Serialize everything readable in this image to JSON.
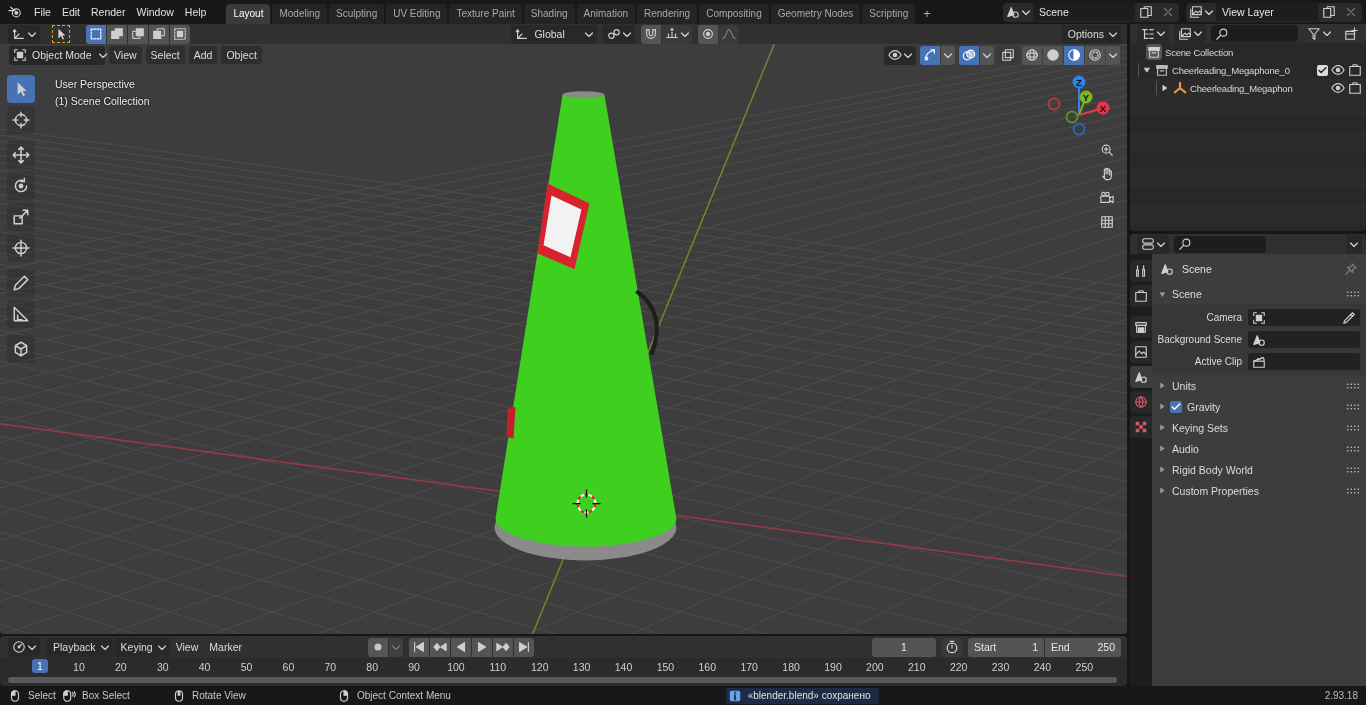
{
  "menu": [
    {
      "label": "File"
    },
    {
      "label": "Edit"
    },
    {
      "label": "Render"
    },
    {
      "label": "Window"
    },
    {
      "label": "Help"
    }
  ],
  "workspaces": [
    {
      "label": "Layout",
      "selected": true
    },
    {
      "label": "Modeling",
      "selected": false
    },
    {
      "label": "Sculpting",
      "selected": false
    },
    {
      "label": "UV Editing",
      "selected": false
    },
    {
      "label": "Texture Paint",
      "selected": false
    },
    {
      "label": "Shading",
      "selected": false
    },
    {
      "label": "Animation",
      "selected": false
    },
    {
      "label": "Rendering",
      "selected": false
    },
    {
      "label": "Compositing",
      "selected": false
    },
    {
      "label": "Geometry Nodes",
      "selected": false
    },
    {
      "label": "Scripting",
      "selected": false
    }
  ],
  "add_workspace": "+",
  "scene_selector": {
    "value": "Scene"
  },
  "view_layer_selector": {
    "value": "View Layer"
  },
  "tool_header": {
    "select_modes": [
      {
        "kind": "set",
        "selected": true
      },
      {
        "kind": "extend",
        "selected": false
      },
      {
        "kind": "subtract",
        "selected": false
      },
      {
        "kind": "invert",
        "selected": false
      },
      {
        "kind": "intersect",
        "selected": false
      }
    ],
    "orientation": "Global",
    "snap_on": false,
    "proportional_editing": false,
    "options": "Options"
  },
  "viewport_header": {
    "mode": "Object Mode",
    "menus": [
      "View",
      "Select",
      "Add",
      "Object"
    ],
    "gizmos_on": true,
    "overlays_on": true,
    "xray_on": false,
    "shading_modes": [
      {
        "kind": "wireframe",
        "selected": false
      },
      {
        "kind": "solid",
        "selected": false
      },
      {
        "kind": "material",
        "selected": true
      },
      {
        "kind": "rendered",
        "selected": false
      }
    ]
  },
  "viewport": {
    "perspective": "User Perspective",
    "collection": "(1) Scene Collection",
    "axes": [
      {
        "label": "Z",
        "color": "#2f83e0"
      },
      {
        "label": "Y",
        "color": "#7db624"
      },
      {
        "label": "X",
        "color": "#e8344c"
      }
    ]
  },
  "toolbar": [
    {
      "kind": "select",
      "selected": true
    },
    {
      "kind": "cursor",
      "selected": false
    },
    {
      "kind": "move",
      "selected": false
    },
    {
      "kind": "rotate",
      "selected": false
    },
    {
      "kind": "scale",
      "selected": false
    },
    {
      "kind": "transform",
      "selected": false
    },
    {
      "kind": "annotate",
      "selected": false
    },
    {
      "kind": "measure",
      "selected": false
    },
    {
      "kind": "add_cube",
      "selected": false
    }
  ],
  "outliner": {
    "root": "Scene Collection",
    "collections": [
      {
        "label": "Cheerleading_Megaphone_0",
        "expanded": true,
        "included": true,
        "visible": true,
        "children": [
          {
            "label": "Cheerleading_Megaphon",
            "expanded": false,
            "visible": true
          }
        ]
      }
    ]
  },
  "properties": {
    "tabs": [
      {
        "kind": "tool",
        "selected": false
      },
      {
        "kind": "render",
        "selected": false
      },
      {
        "kind": "output",
        "selected": false
      },
      {
        "kind": "view_layer",
        "selected": false
      },
      {
        "kind": "scene",
        "selected": true
      },
      {
        "kind": "world",
        "selected": false
      },
      {
        "kind": "texture",
        "selected": false
      }
    ],
    "context": "Scene",
    "panel": {
      "title": "Scene",
      "expanded": true,
      "fields": [
        {
          "label": "Camera",
          "kind": "camera"
        },
        {
          "label": "Background Scene",
          "kind": "scene"
        },
        {
          "label": "Active Clip",
          "kind": "clip"
        }
      ]
    },
    "subpanels": [
      {
        "label": "Units",
        "kind": "plain",
        "expanded": false
      },
      {
        "label": "Gravity",
        "kind": "checkbox",
        "checked": true,
        "expanded": false
      },
      {
        "label": "Keying Sets",
        "kind": "plain",
        "expanded": false
      },
      {
        "label": "Audio",
        "kind": "plain",
        "expanded": false
      },
      {
        "label": "Rigid Body World",
        "kind": "plain",
        "expanded": false
      },
      {
        "label": "Custom Properties",
        "kind": "plain",
        "expanded": false
      }
    ]
  },
  "timeline": {
    "menus": [
      {
        "label": "Playback",
        "dropdown": true
      },
      {
        "label": "Keying",
        "dropdown": true
      },
      {
        "label": "View",
        "dropdown": false
      },
      {
        "label": "Marker",
        "dropdown": false
      }
    ],
    "auto_keying": false,
    "current_frame": "1",
    "start_label": "Start",
    "start": "1",
    "end_label": "End",
    "end": "250",
    "playhead": "1",
    "ruler": [
      "10",
      "20",
      "30",
      "40",
      "50",
      "60",
      "70",
      "80",
      "90",
      "100",
      "110",
      "120",
      "130",
      "140",
      "150",
      "160",
      "170",
      "180",
      "190",
      "200",
      "210",
      "220",
      "230",
      "240",
      "250"
    ]
  },
  "status_bar": {
    "hints": [
      {
        "label": "Select",
        "kind": "left"
      },
      {
        "label": "Box Select",
        "kind": "drag"
      },
      {
        "label": "Rotate View",
        "kind": "middle"
      },
      {
        "label": "Object Context Menu",
        "kind": "right"
      }
    ],
    "message": "«blender.blend» сохранено",
    "version": "2.93.18"
  }
}
